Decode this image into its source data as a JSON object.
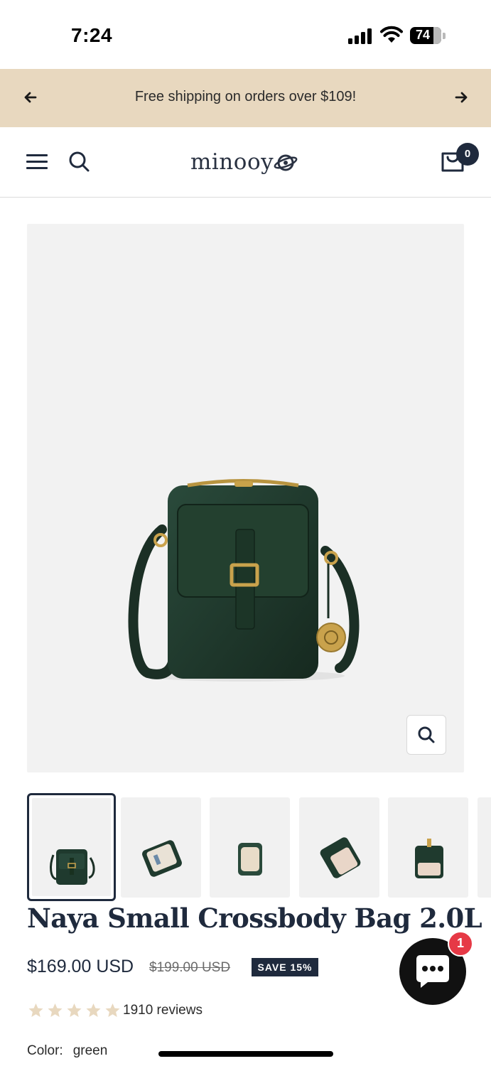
{
  "status_bar": {
    "time": "7:24",
    "battery": "74"
  },
  "announcement": {
    "text": "Free shipping on orders over $109!",
    "prev_icon": "arrow-left-icon",
    "next_icon": "arrow-right-icon"
  },
  "header": {
    "logo": "minooy",
    "menu_icon": "menu-icon",
    "search_icon": "search-icon",
    "cart_icon": "cart-icon",
    "cart_count": "0"
  },
  "product": {
    "title": "Naya Small Crossbody Bag 2.0L",
    "price": "$169.00 USD",
    "compare_price": "$199.00 USD",
    "save_badge": "SAVE 15%",
    "rating_stars": 5,
    "reviews": "1910 reviews",
    "color_label": "Color:",
    "color_value": "green",
    "colors": {
      "bag": "#1f3a2e",
      "star": "#e8d8bf",
      "navy": "#1f2a3d"
    }
  },
  "thumbnails": [
    {
      "view": "front"
    },
    {
      "view": "open-interior"
    },
    {
      "view": "top-open"
    },
    {
      "view": "open-angled"
    },
    {
      "view": "back-open"
    }
  ],
  "chat": {
    "icon": "chat-bubble-icon",
    "badge": "1"
  }
}
